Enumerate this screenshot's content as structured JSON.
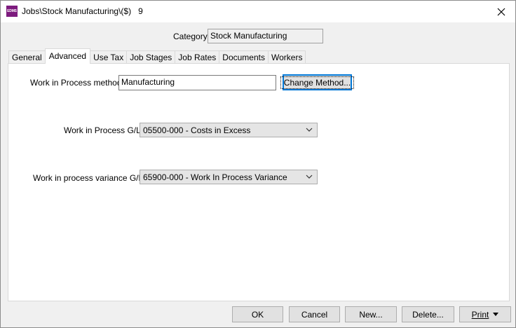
{
  "window": {
    "app_icon_text": "EDMS",
    "title": "Jobs\\Stock Manufacturing\\($)   9"
  },
  "category": {
    "label": "Category:",
    "value": "Stock Manufacturing"
  },
  "tabs": [
    {
      "label": "General"
    },
    {
      "label": "Advanced",
      "active": true
    },
    {
      "label": "Use Tax"
    },
    {
      "label": "Job Stages"
    },
    {
      "label": "Job Rates"
    },
    {
      "label": "Documents"
    },
    {
      "label": "Workers"
    }
  ],
  "advanced": {
    "wip_method_label": "Work in Process method:",
    "wip_method_value": "Manufacturing",
    "change_method_label": "Change Method...",
    "wip_gl_label": "Work in Process G/L:",
    "wip_gl_value": "05500-000 - Costs in Excess",
    "wip_variance_label": "Work in process variance G/L:",
    "wip_variance_value": "65900-000 - Work In Process Variance"
  },
  "footer": {
    "ok_label": "OK",
    "cancel_label": "Cancel",
    "new_label": "New...",
    "delete_label": "Delete...",
    "print_label": "Print"
  },
  "icons": {
    "close": "close-icon",
    "dropdown": "chevron-down-icon",
    "print_menu": "caret-down-icon"
  }
}
